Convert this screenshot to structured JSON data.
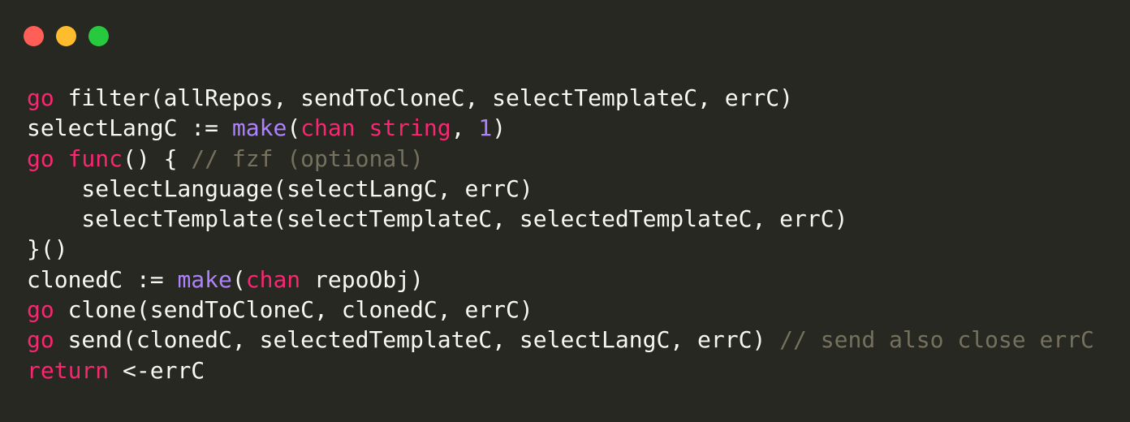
{
  "window": {
    "controls": [
      {
        "name": "close",
        "color": "#ff5f56"
      },
      {
        "name": "minimize",
        "color": "#ffbd2e"
      },
      {
        "name": "maximize",
        "color": "#27c93f"
      }
    ]
  },
  "theme": {
    "background": "#272822",
    "default": "#f8f8f2",
    "keyword": "#f92672",
    "builtin": "#ae81ff",
    "number": "#ae81ff",
    "comment": "#75715e"
  },
  "code": {
    "language": "go",
    "lines": [
      [
        {
          "t": "go",
          "k": "keyword"
        },
        {
          "t": " filter(allRepos, sendToCloneC, selectTemplateC, errC)",
          "k": "default"
        }
      ],
      [
        {
          "t": "selectLangC := ",
          "k": "default"
        },
        {
          "t": "make",
          "k": "builtin"
        },
        {
          "t": "(",
          "k": "default"
        },
        {
          "t": "chan",
          "k": "keyword"
        },
        {
          "t": " ",
          "k": "default"
        },
        {
          "t": "string",
          "k": "keyword"
        },
        {
          "t": ", ",
          "k": "default"
        },
        {
          "t": "1",
          "k": "number"
        },
        {
          "t": ")",
          "k": "default"
        }
      ],
      [
        {
          "t": "go",
          "k": "keyword"
        },
        {
          "t": " ",
          "k": "default"
        },
        {
          "t": "func",
          "k": "keyword"
        },
        {
          "t": "() { ",
          "k": "default"
        },
        {
          "t": "// fzf (optional)",
          "k": "comment"
        }
      ],
      [
        {
          "t": "    selectLanguage(selectLangC, errC)",
          "k": "default"
        }
      ],
      [
        {
          "t": "    selectTemplate(selectTemplateC, selectedTemplateC, errC)",
          "k": "default"
        }
      ],
      [
        {
          "t": "}()",
          "k": "default"
        }
      ],
      [
        {
          "t": "clonedC := ",
          "k": "default"
        },
        {
          "t": "make",
          "k": "builtin"
        },
        {
          "t": "(",
          "k": "default"
        },
        {
          "t": "chan",
          "k": "keyword"
        },
        {
          "t": " repoObj)",
          "k": "default"
        }
      ],
      [
        {
          "t": "go",
          "k": "keyword"
        },
        {
          "t": " clone(sendToCloneC, clonedC, errC)",
          "k": "default"
        }
      ],
      [
        {
          "t": "go",
          "k": "keyword"
        },
        {
          "t": " send(clonedC, selectedTemplateC, selectLangC, errC) ",
          "k": "default"
        },
        {
          "t": "// send also close errC",
          "k": "comment"
        }
      ],
      [
        {
          "t": "return",
          "k": "keyword"
        },
        {
          "t": " <-errC",
          "k": "default"
        }
      ]
    ]
  }
}
